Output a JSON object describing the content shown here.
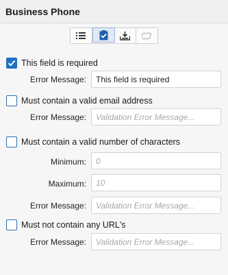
{
  "header": {
    "title": "Business Phone"
  },
  "toolbar": {
    "buttons": [
      {
        "icon": "list-icon",
        "state": "normal"
      },
      {
        "icon": "clipboard-check-icon",
        "state": "active"
      },
      {
        "icon": "download-tray-icon",
        "state": "normal"
      },
      {
        "icon": "eraser-icon",
        "state": "disabled"
      }
    ]
  },
  "colors": {
    "accent": "#1f6fc5",
    "border": "#d3d3d3",
    "placeholder": "#a8a8a8"
  },
  "rules": {
    "required": {
      "label": "This field is required",
      "checked": true,
      "error_label": "Error Message:",
      "error_value": "This field is required",
      "error_placeholder": "Validation Error Message..."
    },
    "email": {
      "label": "Must contain a valid email address",
      "checked": false,
      "error_label": "Error Message:",
      "error_value": "",
      "error_placeholder": "Validation Error Message..."
    },
    "chars": {
      "label": "Must contain a valid number of characters",
      "checked": false,
      "min_label": "Minimum:",
      "min_placeholder": "0",
      "max_label": "Maximum:",
      "max_placeholder": "10",
      "error_label": "Error Message:",
      "error_value": "",
      "error_placeholder": "Validation Error Message..."
    },
    "url": {
      "label": "Must not contain any URL's",
      "checked": false,
      "error_label": "Error Message:",
      "error_value": "",
      "error_placeholder": "Validation Error Message..."
    }
  }
}
